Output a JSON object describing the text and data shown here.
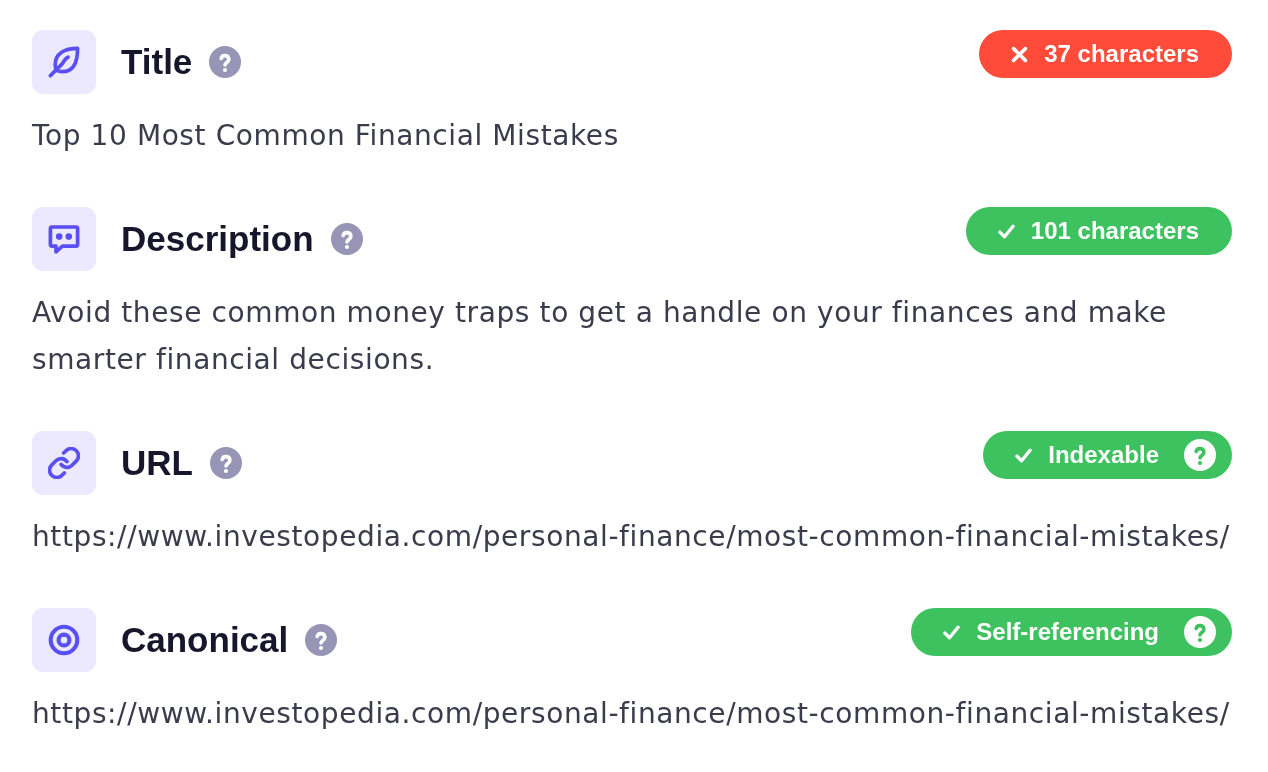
{
  "sections": [
    {
      "kind": "title",
      "heading": "Title",
      "badge": {
        "passed": false,
        "text": "37 characters",
        "help": false
      },
      "value": "Top 10 Most Common Financial Mistakes"
    },
    {
      "kind": "description",
      "heading": "Description",
      "badge": {
        "passed": true,
        "text": "101 characters",
        "help": false
      },
      "value": "Avoid these common money traps to get a handle on your finances and make smarter financial decisions."
    },
    {
      "kind": "url",
      "heading": "URL",
      "badge": {
        "passed": true,
        "text": "Indexable",
        "help": true
      },
      "value": "https://www.investopedia.com/personal-finance/most-common-financial-mistakes/"
    },
    {
      "kind": "canonical",
      "heading": "Canonical",
      "badge": {
        "passed": true,
        "text": "Self-referencing",
        "help": true
      },
      "value": "https://www.investopedia.com/personal-finance/most-common-financial-mistakes/"
    }
  ]
}
